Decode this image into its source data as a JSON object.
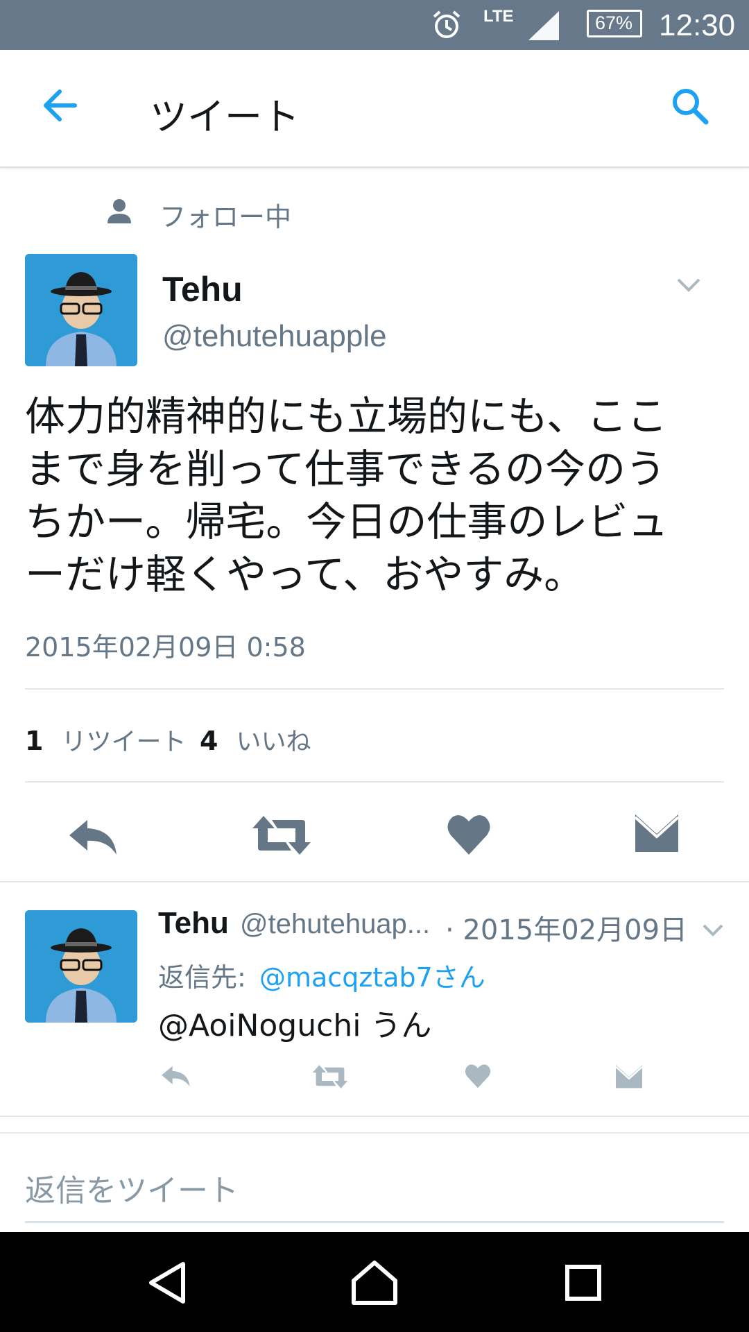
{
  "status_bar": {
    "network": "LTE",
    "battery": "67%",
    "time": "12:30",
    "icons": [
      "alarm-icon",
      "signal-icon",
      "battery-icon"
    ]
  },
  "app_bar": {
    "title": "ツイート",
    "icons": [
      "back-arrow-icon",
      "search-icon"
    ],
    "accent_color": "#1da1f2"
  },
  "tweet": {
    "context": "フォロー中",
    "display_name": "Tehu",
    "handle": "@tehutehuapple",
    "text_lines": [
      "体力的精神的にも立場的にも、ここ",
      "まで身を削って仕事できるの今のう",
      "ちかー。帰宅。今日の仕事のレビュ",
      "ーだけ軽くやって、おやすみ。"
    ],
    "timestamp": "2015年02月09日 0:58",
    "stats": {
      "retweet_count": "1",
      "retweet_label": "リツイート",
      "like_count": "4",
      "like_label": "いいね"
    },
    "actions": [
      "reply-icon",
      "retweet-icon",
      "like-icon",
      "direct-message-icon"
    ]
  },
  "reply": {
    "display_name": "Tehu",
    "handle": "@tehutehuap...",
    "date": "· 2015年02月09日",
    "reply_to_label": "返信先:",
    "reply_to_user": "@macqztab7さん",
    "text": "@AoiNoguchi うん"
  },
  "compose": {
    "placeholder": "返信をツイート"
  },
  "nav_bar": {
    "icons": [
      "back-triangle-icon",
      "home-icon",
      "recents-icon"
    ]
  }
}
